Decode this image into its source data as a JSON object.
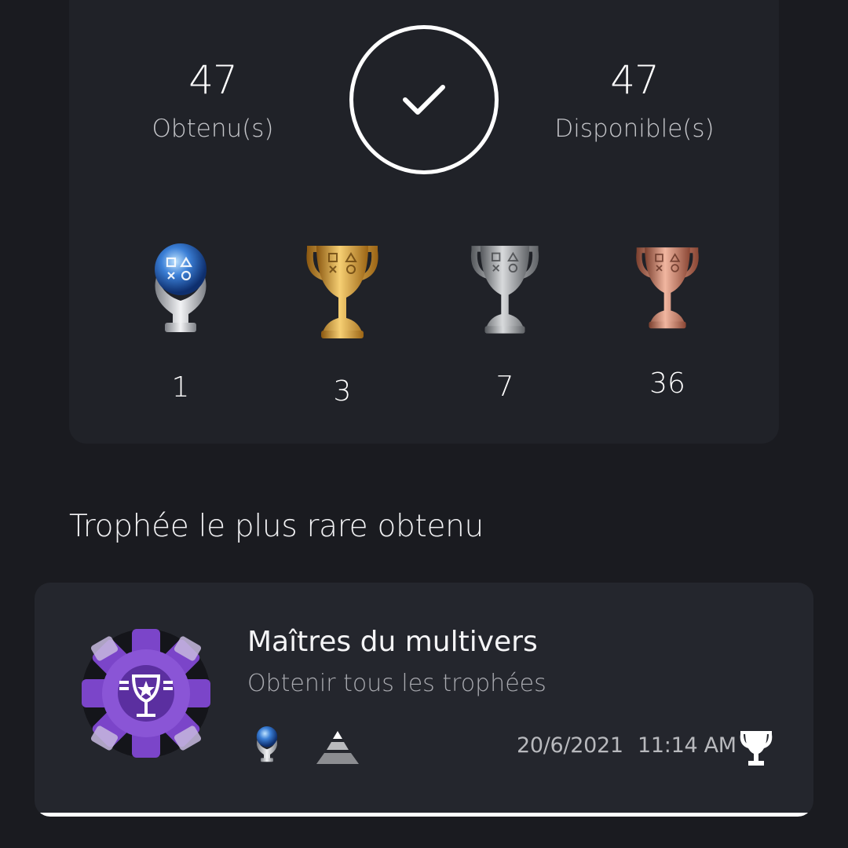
{
  "summary": {
    "earned_count": "47",
    "earned_label": "Obtenu(s)",
    "available_count": "47",
    "available_label": "Disponible(s)",
    "trophies": [
      {
        "type": "platinum",
        "count": "1"
      },
      {
        "type": "gold",
        "count": "3"
      },
      {
        "type": "silver",
        "count": "7"
      },
      {
        "type": "bronze",
        "count": "36"
      }
    ]
  },
  "rarest": {
    "section_title": "Trophée le plus rare obtenu",
    "name": "Maîtres du multivers",
    "description": "Obtenir tous les trophées",
    "trophy_type": "platinum",
    "rarity_icon": "pyramid-rarity-icon",
    "date": "20/6/2021",
    "time": "11:14 AM",
    "earned_icon": "trophy-icon"
  },
  "colors": {
    "background": "#1a1b20",
    "card": "#202228",
    "platinum": "#3b7fd6",
    "gold": "#d59a2e",
    "silver": "#a8aaad",
    "bronze": "#c27a64",
    "badge_purple": "#7b45c9"
  }
}
